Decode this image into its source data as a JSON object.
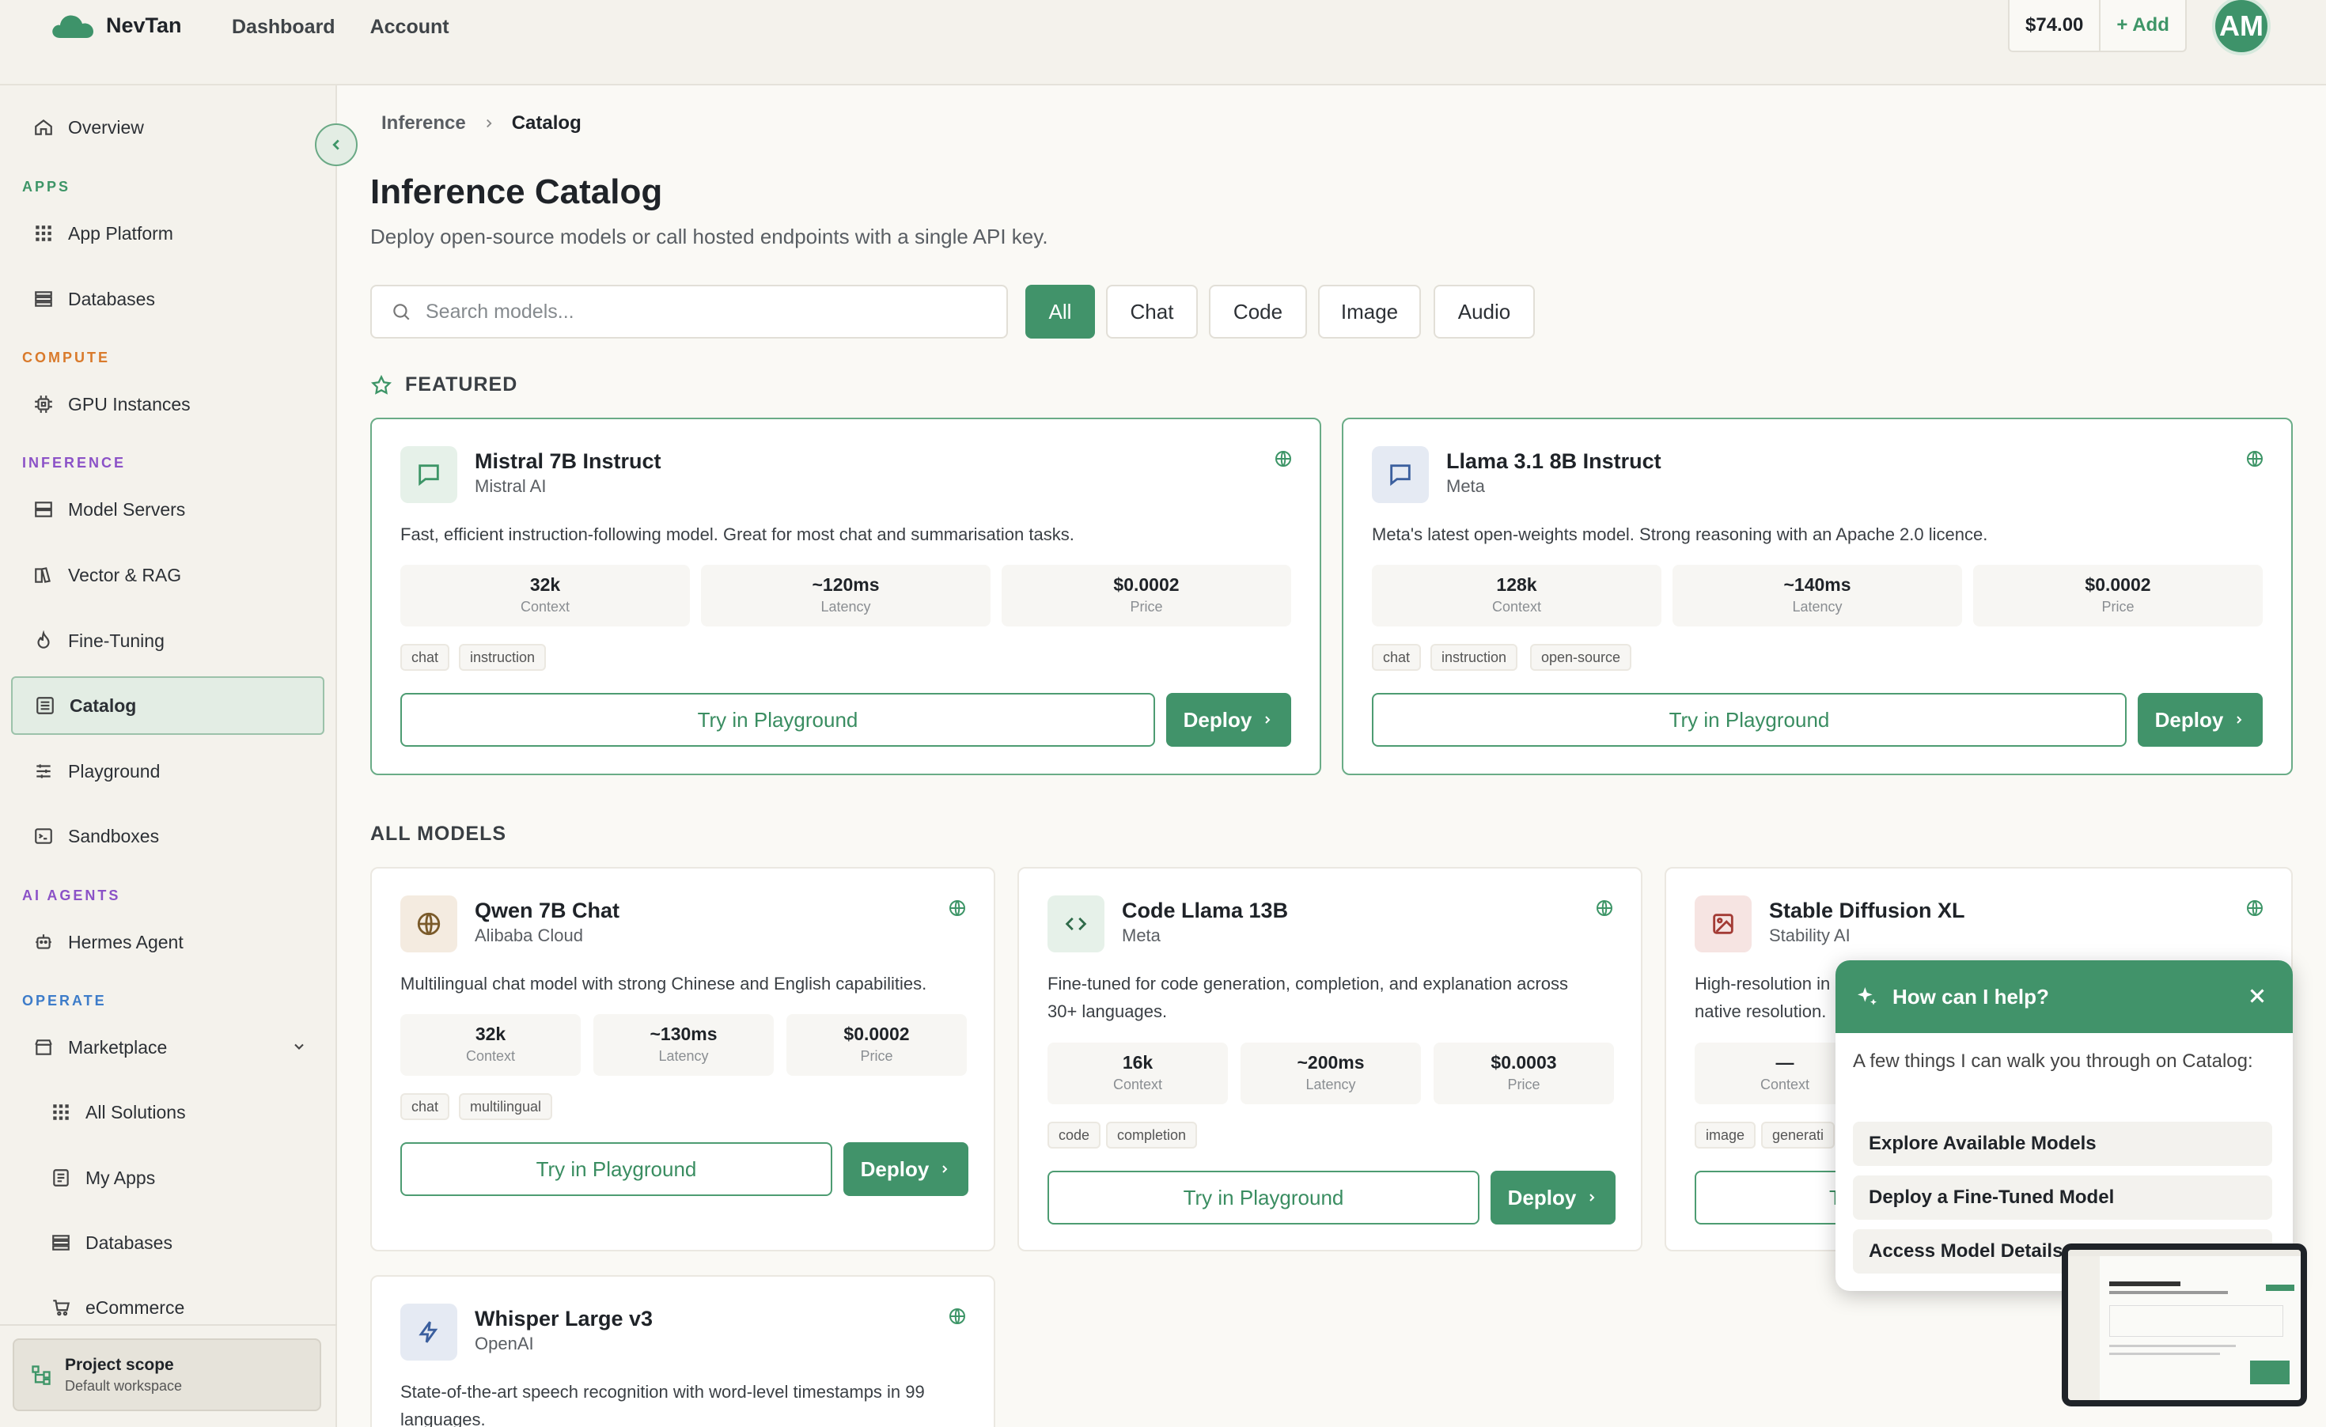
{
  "app": {
    "name": "NevTan",
    "nav": [
      "Dashboard",
      "Account"
    ],
    "balance": "$74.00",
    "add_label": "+ Add",
    "avatar": "AM"
  },
  "sidebar": {
    "overview": "Overview",
    "sections": {
      "apps": "APPS",
      "compute": "COMPUTE",
      "inference": "INFERENCE",
      "agents": "AI AGENTS",
      "operate": "OPERATE"
    },
    "items": {
      "app_platform": "App Platform",
      "databases": "Databases",
      "gpu": "GPU Instances",
      "model_servers": "Model Servers",
      "vector": "Vector & RAG",
      "fine_tuning": "Fine-Tuning",
      "catalog": "Catalog",
      "playground": "Playground",
      "sandboxes": "Sandboxes",
      "hermes": "Hermes Agent",
      "marketplace": "Marketplace",
      "all_solutions": "All Solutions",
      "my_apps": "My Apps",
      "databases2": "Databases",
      "ecommerce": "eCommerce"
    },
    "project": {
      "title": "Project scope",
      "subtitle": "Default workspace"
    },
    "colors": {
      "apps": "#3d9567",
      "compute": "#d97a2b",
      "inference": "#8b52c7",
      "agents": "#8b52c7",
      "operate": "#3d7cc9"
    }
  },
  "breadcrumb": [
    "Inference",
    "Catalog"
  ],
  "page": {
    "title": "Inference Catalog",
    "subtitle": "Deploy open-source models or call hosted endpoints with a single API key."
  },
  "search": {
    "placeholder": "Search models..."
  },
  "filters": [
    "All",
    "Chat",
    "Code",
    "Image",
    "Audio"
  ],
  "featured_label": "FEATURED",
  "all_models_label": "ALL MODELS",
  "cards": [
    {
      "name": "Mistral 7B Instruct",
      "org": "Mistral AI",
      "desc": "Fast, efficient instruction-following model. Great for most chat and summarisation tasks.",
      "stats": [
        {
          "v": "32k",
          "l": "Context"
        },
        {
          "v": "~120ms",
          "l": "Latency"
        },
        {
          "v": "$0.0002",
          "l": "Price"
        }
      ],
      "tags": [
        "chat",
        "instruction"
      ],
      "try": "Try in Playground",
      "deploy": "Deploy"
    },
    {
      "name": "Llama 3.1 8B Instruct",
      "org": "Meta",
      "desc": "Meta's latest open-weights model. Strong reasoning with an Apache 2.0 licence.",
      "stats": [
        {
          "v": "128k",
          "l": "Context"
        },
        {
          "v": "~140ms",
          "l": "Latency"
        },
        {
          "v": "$0.0002",
          "l": "Price"
        }
      ],
      "tags": [
        "chat",
        "instruction",
        "open-source"
      ],
      "try": "Try in Playground",
      "deploy": "Deploy"
    },
    {
      "name": "Qwen 7B Chat",
      "org": "Alibaba Cloud",
      "desc": "Multilingual chat model with strong Chinese and English capabilities.",
      "stats": [
        {
          "v": "32k",
          "l": "Context"
        },
        {
          "v": "~130ms",
          "l": "Latency"
        },
        {
          "v": "$0.0002",
          "l": "Price"
        }
      ],
      "tags": [
        "chat",
        "multilingual"
      ],
      "try": "Try in Playground",
      "deploy": "Deploy"
    },
    {
      "name": "Code Llama 13B",
      "org": "Meta",
      "desc1": "Fine-tuned for code generation, completion, and explanation across",
      "desc2": "30+ languages.",
      "stats": [
        {
          "v": "16k",
          "l": "Context"
        },
        {
          "v": "~200ms",
          "l": "Latency"
        },
        {
          "v": "$0.0003",
          "l": "Price"
        }
      ],
      "tags": [
        "code",
        "completion"
      ],
      "try": "Try in Playground",
      "deploy": "Deploy"
    },
    {
      "name": "Stable Diffusion XL",
      "org": "Stability AI",
      "desc1": "High-resolution in",
      "desc2": "native resolution.",
      "stats": [
        {
          "v": "—",
          "l": "Context"
        }
      ],
      "tags": [
        "image",
        "generati"
      ],
      "try": "T"
    },
    {
      "name": "Whisper Large v3",
      "org": "OpenAI",
      "desc1": "State-of-the-art speech recognition with word-level timestamps in 99",
      "desc2": "languages."
    }
  ],
  "help": {
    "title": "How can I help?",
    "intro": "A few things I can walk you through on Catalog:",
    "options": [
      "Explore Available Models",
      "Deploy a Fine-Tuned Model",
      "Access Model Details"
    ]
  }
}
